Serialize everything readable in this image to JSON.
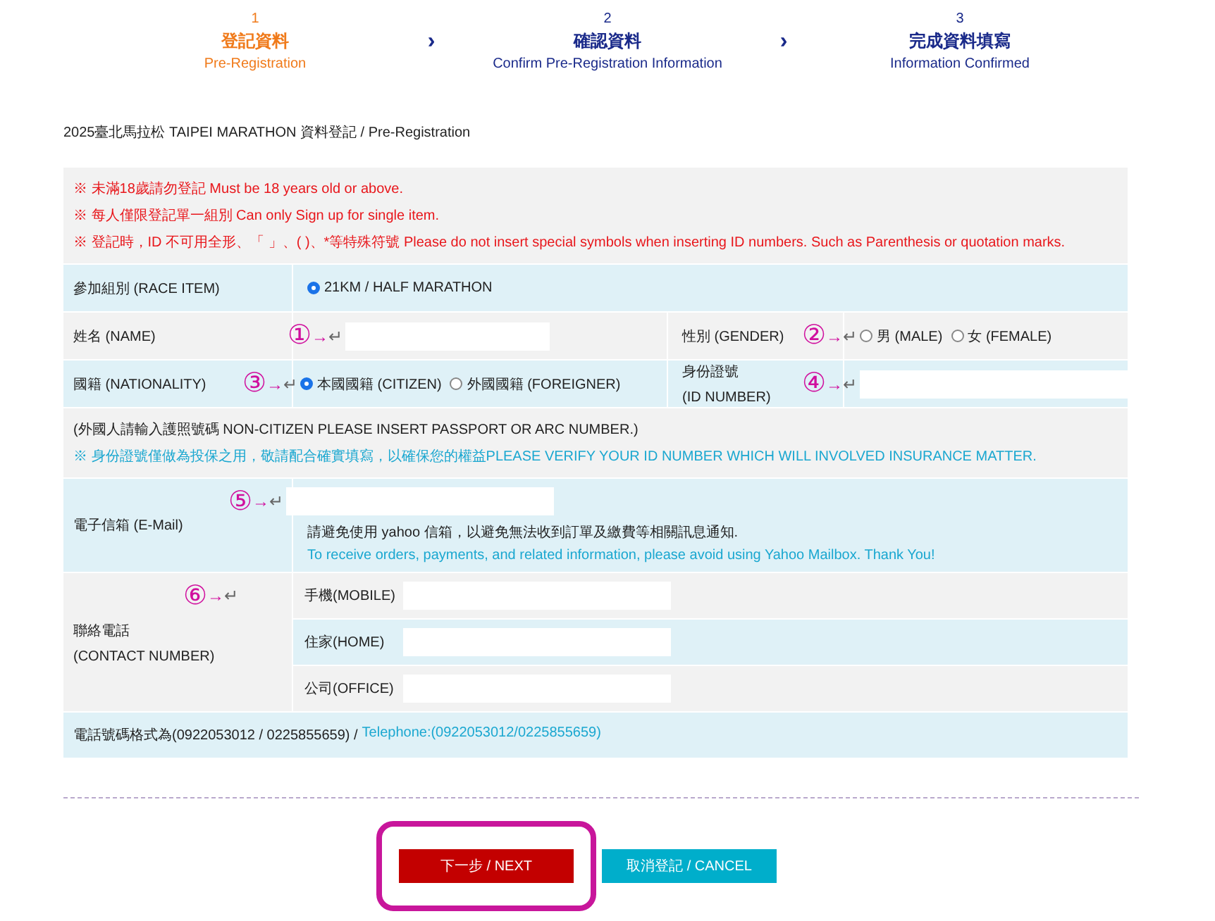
{
  "steps": [
    {
      "number": "1",
      "title": "登記資料",
      "subtitle": "Pre-Registration",
      "selected": true
    },
    {
      "number": "2",
      "title": "確認資料",
      "subtitle": "Confirm Pre-Registration Information",
      "selected": false
    },
    {
      "number": "3",
      "title": "完成資料填寫",
      "subtitle": "Information Confirmed",
      "selected": false
    }
  ],
  "step_separator": "›",
  "page_title": "2025臺北馬拉松 TAIPEI MARATHON 資料登記 / Pre-Registration",
  "notices": [
    "※ 未滿18歲請勿登記 Must be 18 years old or above.",
    "※ 每人僅限登記單一組別 Can only Sign up for single item.",
    "※ 登記時，ID 不可用全形、「 」、( )、*等特殊符號 Please do not insert special symbols when inserting ID numbers. Such as Parenthesis or quotation marks."
  ],
  "race_item": {
    "label": "參加組別 (RACE ITEM)",
    "options": [
      {
        "label": "21KM / HALF MARATHON",
        "selected": true
      }
    ]
  },
  "name": {
    "label": "姓名 (NAME)",
    "annotation": {
      "marker": "①",
      "arrow": "→",
      "return": "↵"
    }
  },
  "gender": {
    "label": "性別 (GENDER)",
    "annotation": {
      "marker": "②",
      "arrow": "→",
      "return": "↵"
    },
    "options": [
      {
        "label": "男 (MALE)",
        "selected": false
      },
      {
        "label": "女 (FEMALE)",
        "selected": false
      }
    ]
  },
  "nationality": {
    "label": "國籍 (NATIONALITY)",
    "annotation": {
      "marker": "③",
      "arrow": "→",
      "return": "↵"
    },
    "options": [
      {
        "label": "本國國籍 (CITIZEN)",
        "selected": true
      },
      {
        "label": "外國國籍 (FOREIGNER)",
        "selected": false
      }
    ]
  },
  "id_number": {
    "label": "身份證號",
    "label_en": "(ID NUMBER)",
    "annotation": {
      "marker": "④",
      "arrow": "→",
      "return": "↵"
    }
  },
  "id_notes": [
    "(外國人請輸入護照號碼 NON-CITIZEN PLEASE INSERT PASSPORT OR ARC NUMBER.)",
    "※ 身份證號僅做為投保之用，敬請配合確實填寫，以確保您的權益PLEASE VERIFY YOUR ID NUMBER WHICH WILL INVOLVED INSURANCE MATTER."
  ],
  "email": {
    "label": "電子信箱 (E-Mail)",
    "annotation": {
      "marker": "⑤",
      "arrow": "→",
      "return": "↵"
    },
    "note": "請避免使用 yahoo 信箱，以避免無法收到訂單及繳費等相關訊息通知.",
    "note_en": "To receive orders, payments, and related information, please avoid using Yahoo Mailbox. Thank You!"
  },
  "contact": {
    "label": "聯絡電話",
    "label_en": "(CONTACT NUMBER)",
    "annotation": {
      "marker": "⑥",
      "arrow": "→",
      "return": "↵"
    },
    "phones": [
      {
        "label": "手機(MOBILE)"
      },
      {
        "label": "住家(HOME)"
      },
      {
        "label": "公司(OFFICE)"
      }
    ]
  },
  "phone_format": {
    "text": "電話號碼格式為(0922053012 / 0225855659) /",
    "text_en": "Telephone:(0922053012/0225855659)"
  },
  "buttons": [
    {
      "label": "下一步 / NEXT",
      "kind": "primary",
      "highlighted": true
    },
    {
      "label": "取消登記 / CANCEL",
      "kind": "secondary",
      "highlighted": false
    }
  ]
}
